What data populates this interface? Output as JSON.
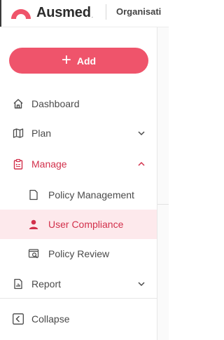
{
  "header": {
    "brand": "Ausmed",
    "brand_mark": ".",
    "org_link": "Organisati"
  },
  "add_button": {
    "label": "Add",
    "icon": "plus-icon"
  },
  "nav": {
    "dashboard": {
      "label": "Dashboard",
      "icon": "home-icon"
    },
    "plan": {
      "label": "Plan",
      "icon": "map-icon",
      "expanded": false
    },
    "manage": {
      "label": "Manage",
      "icon": "clipboard-icon",
      "expanded": true,
      "children": [
        {
          "label": "Policy Management",
          "icon": "document-icon"
        },
        {
          "label": "User Compliance",
          "icon": "user-icon",
          "active": true
        },
        {
          "label": "Policy Review",
          "icon": "review-icon"
        }
      ]
    },
    "report": {
      "label": "Report",
      "icon": "report-icon",
      "expanded": false
    },
    "collapse": {
      "label": "Collapse",
      "icon": "chevron-left-icon"
    }
  },
  "colors": {
    "brand": "#ef546b",
    "active_text": "#d2304b",
    "active_bg": "#fde9ec"
  }
}
